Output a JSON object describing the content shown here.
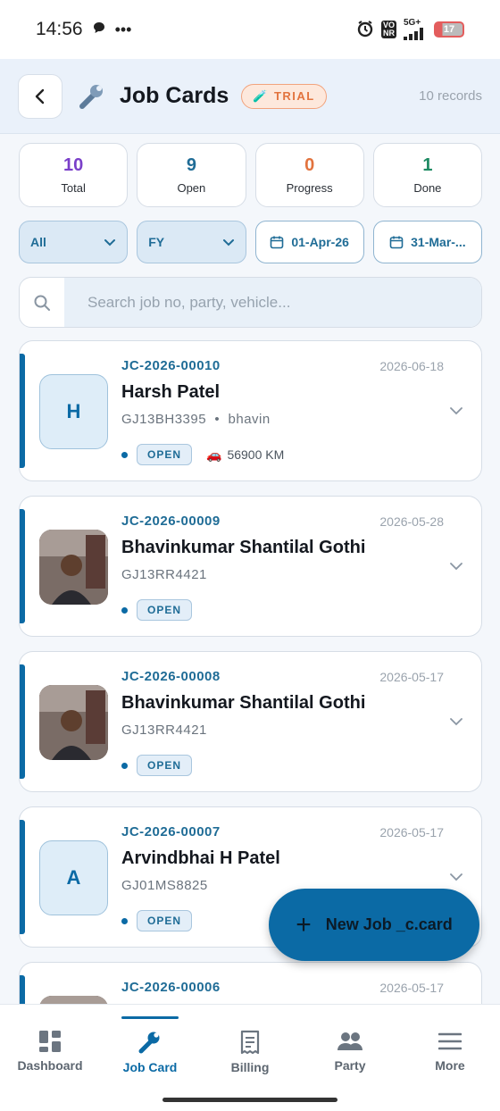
{
  "status_bar": {
    "time": "14:56",
    "network": "5G+",
    "battery": "17"
  },
  "header": {
    "title": "Job Cards",
    "trial_badge": "TRIAL",
    "records": "10 records"
  },
  "stats": [
    {
      "value": "10",
      "label": "Total",
      "color": "#7a3fc9"
    },
    {
      "value": "9",
      "label": "Open",
      "color": "#1f6c96"
    },
    {
      "value": "0",
      "label": "Progress",
      "color": "#e2733e"
    },
    {
      "value": "1",
      "label": "Done",
      "color": "#1e8a63"
    }
  ],
  "filters": {
    "status": "All",
    "period": "FY",
    "from_date": "01-Apr-26",
    "to_date": "31-Mar-..."
  },
  "search": {
    "placeholder": "Search job no, party, vehicle..."
  },
  "jobs": [
    {
      "no": "JC-2026-00010",
      "date": "2026-06-18",
      "name": "Harsh Patel",
      "vehicle": "GJ13BH3395",
      "sep": "•",
      "person": "bhavin",
      "status": "OPEN",
      "km": "56900 KM",
      "initial": "H"
    },
    {
      "no": "JC-2026-00009",
      "date": "2026-05-28",
      "name": "Bhavinkumar Shantilal Gothi",
      "vehicle": "GJ13RR4421",
      "status": "OPEN"
    },
    {
      "no": "JC-2026-00008",
      "date": "2026-05-17",
      "name": "Bhavinkumar Shantilal Gothi",
      "vehicle": "GJ13RR4421",
      "status": "OPEN"
    },
    {
      "no": "JC-2026-00007",
      "date": "2026-05-17",
      "name": "Arvindbhai H Patel",
      "vehicle": "GJ01MS8825",
      "status": "OPEN",
      "initial": "A"
    },
    {
      "no": "JC-2026-00006",
      "date": "2026-05-17"
    }
  ],
  "fab": {
    "label": "New Job _c.card"
  },
  "nav": {
    "dashboard": "Dashboard",
    "jobcard": "Job Card",
    "billing": "Billing",
    "party": "Party",
    "more": "More"
  }
}
